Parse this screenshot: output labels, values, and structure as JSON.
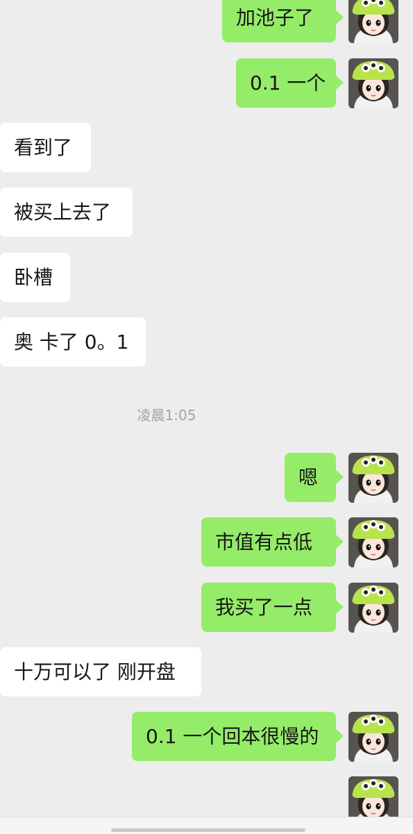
{
  "messages": [
    {
      "dir": "out",
      "text": "加池子了"
    },
    {
      "dir": "out",
      "text": "0.1 一个"
    },
    {
      "dir": "in",
      "text": "看到了"
    },
    {
      "dir": "in",
      "text": "被买上去了"
    },
    {
      "dir": "in",
      "text": "卧槽"
    },
    {
      "dir": "in",
      "text": "奥 卡了 0。1"
    },
    {
      "dir": "time",
      "text": "凌晨1:05"
    },
    {
      "dir": "out",
      "text": "嗯"
    },
    {
      "dir": "out",
      "text": "市值有点低"
    },
    {
      "dir": "out",
      "text": "我买了一点"
    },
    {
      "dir": "in",
      "text": "十万可以了 刚开盘"
    },
    {
      "dir": "out",
      "text": "0.1 一个回本很慢的"
    }
  ],
  "colors": {
    "background": "#ededed",
    "bubble_out": "#95ec69",
    "bubble_in": "#ffffff",
    "text": "#161616",
    "timestamp": "#a3a3a3"
  },
  "avatar_icon": "alien-hat-girl-avatar"
}
